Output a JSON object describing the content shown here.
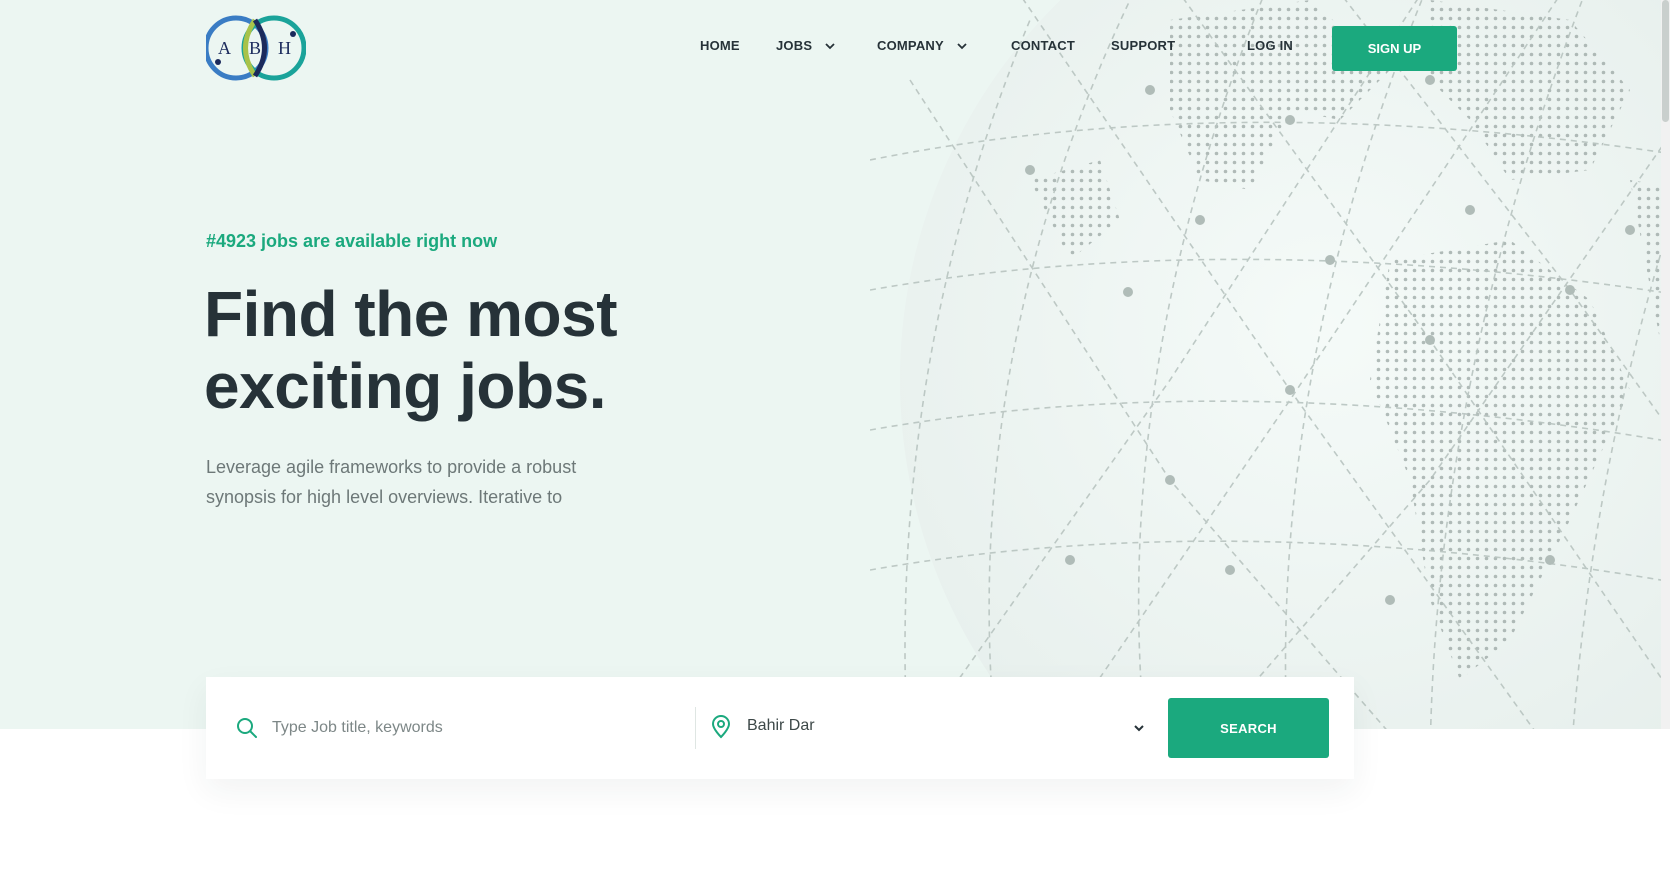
{
  "brand": {
    "logo_letters": [
      "A",
      "B",
      "H"
    ]
  },
  "nav": {
    "home": "HOME",
    "jobs": "JOBS",
    "company": "COMPANY",
    "contact": "CONTACT",
    "support": "SUPPORT",
    "login": "LOG IN",
    "signup": "SIGN UP"
  },
  "hero": {
    "available": "#4923 jobs are available right now",
    "headline_line1": "Find the most",
    "headline_line2": "exciting jobs.",
    "lede": "Leverage agile frameworks to provide a robust synopsis for high level overviews. Iterative to"
  },
  "search": {
    "placeholder": "Type Job title, keywords",
    "location": "Bahir Dar",
    "button": "SEARCH"
  },
  "colors": {
    "accent": "#1ba97e",
    "hero_bg": "#ecf6f2",
    "text_dark": "#263238",
    "text_muted": "#6d7878"
  },
  "icons": [
    "search-icon",
    "map-pin-icon",
    "chevron-down-icon"
  ]
}
